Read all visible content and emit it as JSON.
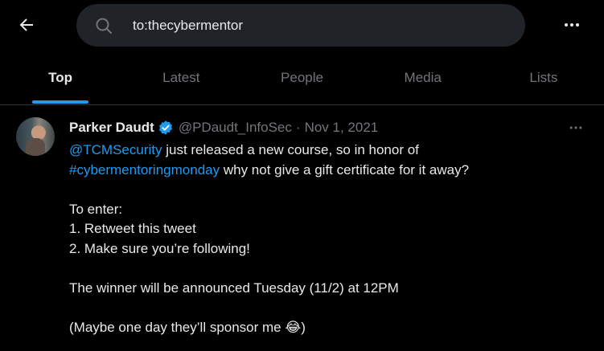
{
  "header": {
    "search_value": "to:thecybermentor",
    "back_icon": "arrow-left-icon",
    "search_icon": "search-icon",
    "more_icon": "more-horizontal-icon"
  },
  "tabs": [
    {
      "label": "Top",
      "active": true
    },
    {
      "label": "Latest"
    },
    {
      "label": "People"
    },
    {
      "label": "Media"
    },
    {
      "label": "Lists"
    }
  ],
  "tweet": {
    "author_name": "Parker Daudt",
    "author_handle": "@PDaudt_InfoSec",
    "separator": "·",
    "date": "Nov 1, 2021",
    "verified": true,
    "mention": "@TCMSecurity",
    "line1_rest": " just released a new course, so in honor of",
    "hashtag": "#cybermentoringmonday",
    "line2_rest": " why not give a gift certificate for it away?",
    "line3": "To enter:",
    "line4": "1. Retweet this tweet",
    "line5": "2. Make sure you’re following!",
    "line6": "The winner will be announced Tuesday (11/2) at 12PM",
    "line7": "(Maybe one day they’ll sponsor me ",
    "emoji": "😂",
    "line7_end": ")"
  },
  "colors": {
    "background": "#000000",
    "text": "#e7e9ea",
    "muted": "#71767b",
    "accent": "#1d9bf0",
    "search_bg": "#202327"
  }
}
